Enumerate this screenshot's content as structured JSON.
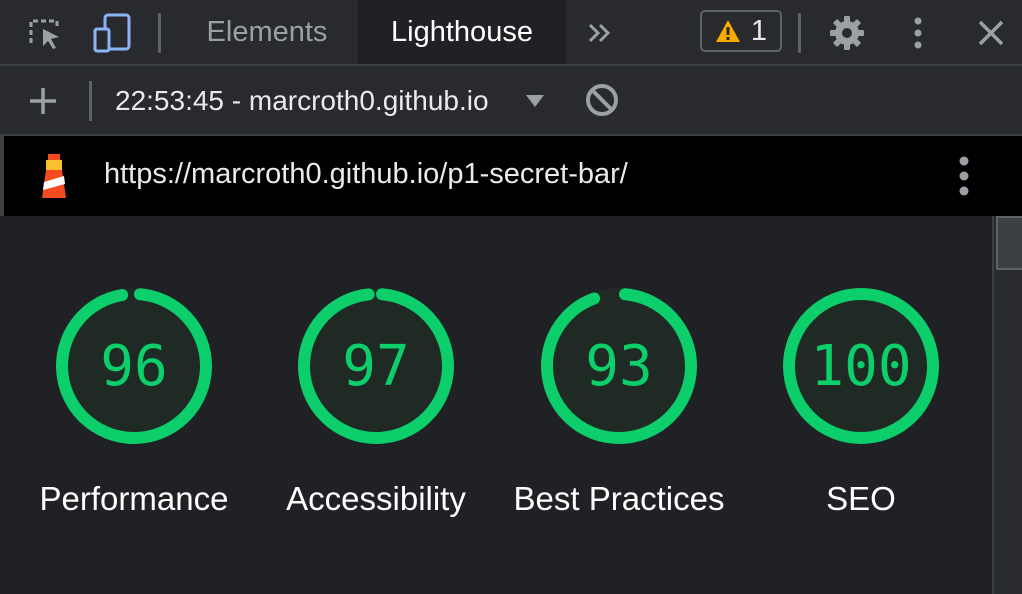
{
  "devtools": {
    "tabs": [
      {
        "label": "Elements",
        "active": false
      },
      {
        "label": "Lighthouse",
        "active": true
      }
    ],
    "more_tabs_icon": "double-chevron-right-icon",
    "issues_count": "1",
    "icons": [
      "inspect-element-icon",
      "device-toolbar-icon",
      "warning-icon",
      "gear-icon",
      "kebab-menu-icon",
      "close-icon"
    ]
  },
  "lighthouse_toolbar": {
    "add_icon": "plus-icon",
    "report_selector": "22:53:45 - marcroth0.github.io",
    "clear_icon": "block-icon"
  },
  "report": {
    "url": "https://marcroth0.github.io/p1-secret-bar/",
    "logo": "lighthouse-logo",
    "menu_icon": "kebab-menu-icon"
  },
  "scores": [
    {
      "label": "Performance",
      "score": "96",
      "value": 96
    },
    {
      "label": "Accessibility",
      "score": "97",
      "value": 97
    },
    {
      "label": "Best Practices",
      "score": "93",
      "value": 93
    },
    {
      "label": "SEO",
      "score": "100",
      "value": 100
    }
  ],
  "colors": {
    "pass": "#0cce6b",
    "pass_bg": "#1f2a24",
    "panel_bg": "#202124",
    "toolbar_bg": "#292a2d"
  }
}
